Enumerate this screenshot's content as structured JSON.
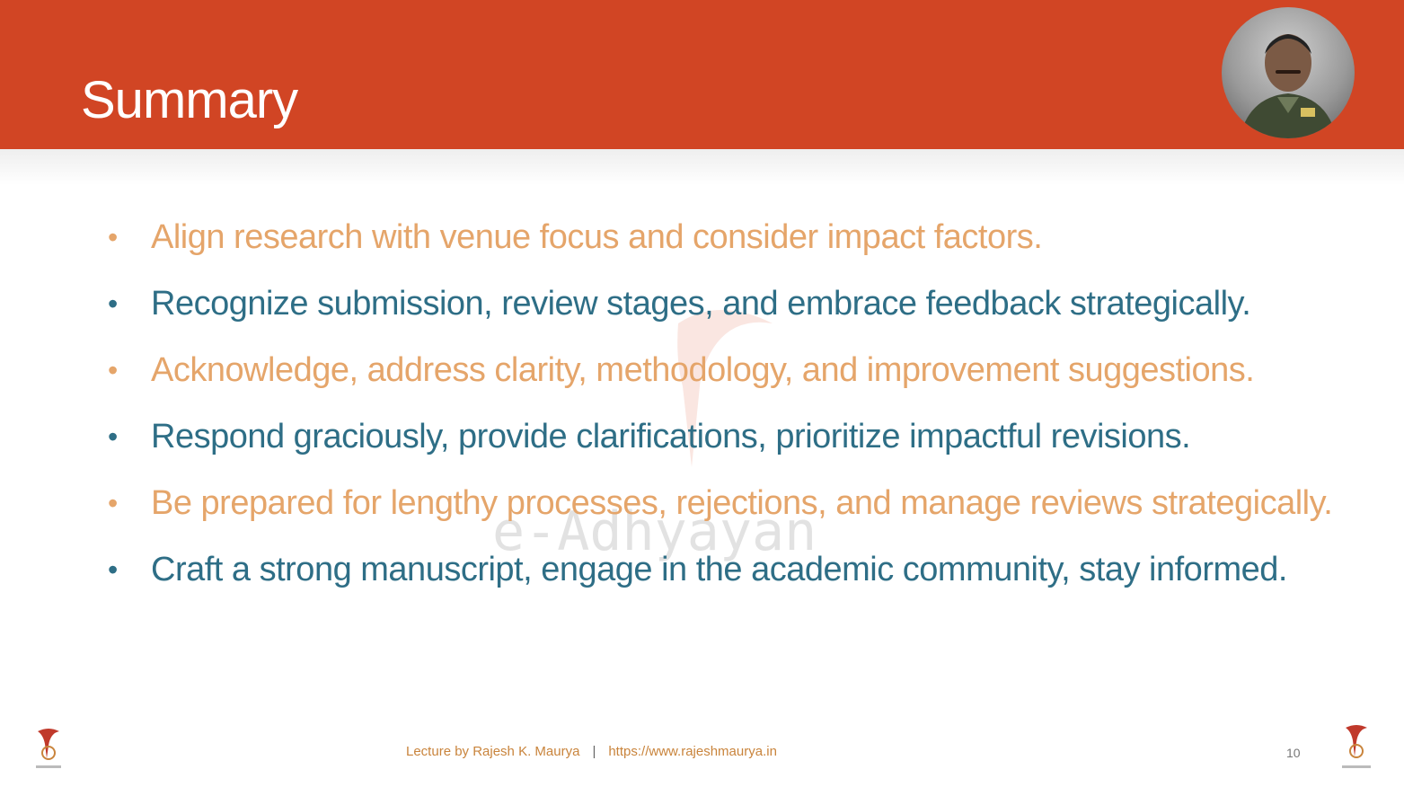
{
  "slide": {
    "title": "Summary",
    "watermark_text": "e-Adhyayan",
    "bullets": [
      {
        "text": "Align research with venue focus and consider impact factors.",
        "color": "#e5a56a"
      },
      {
        "text": "Recognize submission, review stages, and embrace feedback strategically.",
        "color": "#2e6e86"
      },
      {
        "text": "Acknowledge, address clarity, methodology, and improvement suggestions.",
        "color": "#e5a56a"
      },
      {
        "text": "Respond graciously, provide clarifications, prioritize impactful revisions.",
        "color": "#2e6e86"
      },
      {
        "text": "Be prepared for lengthy processes, rejections, and manage reviews strategically.",
        "color": "#e5a56a"
      },
      {
        "text": "Craft a strong manuscript, engage in the academic community, stay informed.",
        "color": "#2e6e86"
      }
    ]
  },
  "footer": {
    "lecture_text": "Lecture by Rajesh K. Maurya",
    "separator": "|",
    "url": "https://www.rajeshmaurya.in",
    "page_number": "10"
  },
  "colors": {
    "header": "#d14524",
    "bullet_orange": "#e5a56a",
    "bullet_teal": "#2e6e86"
  },
  "icons": {
    "avatar": "presenter-photo",
    "logo_left": "e-adhyayan-logo",
    "logo_right": "e-adhyayan-logo"
  }
}
